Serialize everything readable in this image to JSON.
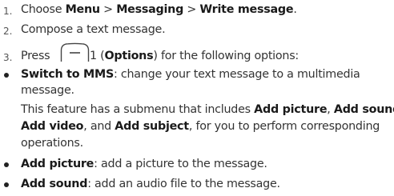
{
  "steps": [
    {
      "number": "1.",
      "pre": "Choose ",
      "path": [
        "Menu",
        "Messaging",
        "Write message"
      ],
      "sep": " > ",
      "post": "."
    },
    {
      "number": "2.",
      "text": "Compose a text message."
    },
    {
      "number": "3.",
      "pre": "Press",
      "key_suffix": "1 (",
      "key_label": "Options",
      "post": ") for the following options:"
    }
  ],
  "options": [
    {
      "term": "Switch to MMS",
      "desc_line1": ": change your text message to a multimedia",
      "desc_line2": "message."
    },
    {
      "term": "Add picture",
      "desc": ": add a picture to the message."
    },
    {
      "term": "Add sound",
      "desc": ": add an audio file to the message."
    }
  ],
  "submenu_note": {
    "line1_pre": "This feature has a submenu that includes ",
    "item1": "Add picture",
    "line1_sep": ", ",
    "item2": "Add sound",
    "line1_end": ",",
    "item3": "Add video",
    "line2_mid": ", and ",
    "item4": "Add subject",
    "line2_post": ", for you to perform corresponding",
    "line3": "operations."
  },
  "icons": {
    "options_key": "softkey-icon"
  }
}
